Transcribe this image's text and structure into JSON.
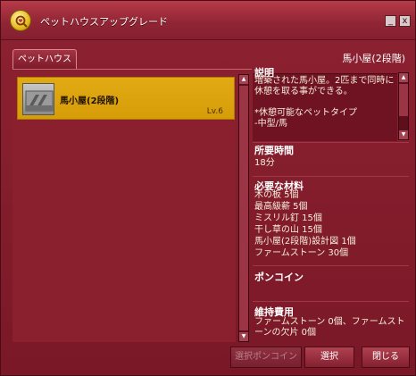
{
  "window": {
    "title": "ペットハウスアップグレード",
    "minimize_label": "_",
    "close_label": "x"
  },
  "tabs": [
    {
      "label": "ペットハウス"
    }
  ],
  "list": {
    "items": [
      {
        "name": "馬小屋(2段階)",
        "level": "Lv.6",
        "icon": "stable-icon"
      }
    ]
  },
  "detail": {
    "title": "馬小屋(2段階)",
    "description_label": "説明",
    "description_text": "増築された馬小屋。2匹まで同時に休憩を取る事ができる。\n\n*休憩可能なペットタイプ\n-中型/馬",
    "time_label": "所要時間",
    "time_value": "18分",
    "materials_label": "必要な材料",
    "materials": [
      "木の板 5個",
      "最高級薪 5個",
      "ミスリル釘 15個",
      "干し草の山 15個",
      "馬小屋(2段階)設計図 1個",
      "ファームストーン 30個"
    ],
    "coin_label": "ポンコイン",
    "upkeep_label": "維持費用",
    "upkeep_text": "ファームストーン 0個、ファームストーンの欠片 0個"
  },
  "buttons": {
    "select_coin": "選択ポンコイン",
    "select": "選択",
    "close": "閉じる"
  },
  "colors": {
    "window_bg": "#8d2231",
    "selected_item": "#e1aa13",
    "text": "#ffffff"
  }
}
